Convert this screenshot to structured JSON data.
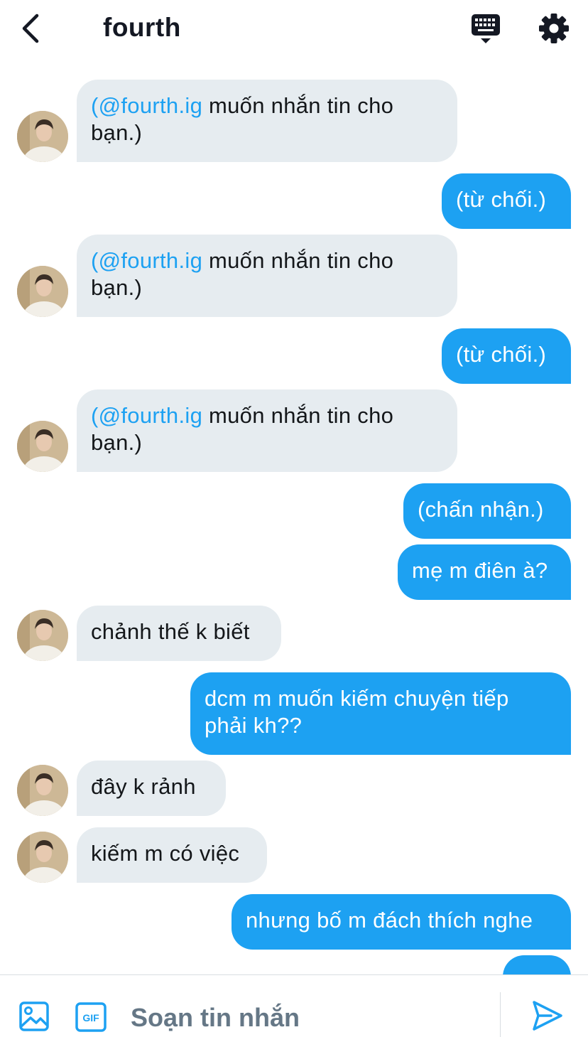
{
  "header": {
    "title": "fourth",
    "back_icon": "chevron-left-icon",
    "keyboard_icon": "keyboard-icon",
    "settings_icon": "gear-icon"
  },
  "colors": {
    "accent": "#1da1f2",
    "incoming_bubble": "#e6ecf0",
    "text": "#14171a",
    "placeholder": "#657786"
  },
  "messages": [
    {
      "dir": "in",
      "mention": "(@fourth.ig",
      "line1_rest": " muốn nhắn tin cho",
      "line2": "bạn.)"
    },
    {
      "dir": "out",
      "text": "(từ chối.)"
    },
    {
      "dir": "in",
      "mention": "(@fourth.ig",
      "line1_rest": " muốn nhắn tin cho",
      "line2": "bạn.)"
    },
    {
      "dir": "out",
      "text": "(từ chối.)"
    },
    {
      "dir": "in",
      "mention": "(@fourth.ig",
      "line1_rest": " muốn nhắn tin cho",
      "line2": "bạn.)"
    },
    {
      "dir": "out",
      "text": "(chấn nhận.)"
    },
    {
      "dir": "out",
      "text": "mẹ m điên à?"
    },
    {
      "dir": "in",
      "text": "chảnh thế k biết"
    },
    {
      "dir": "out",
      "line1": "dcm m muốn kiếm chuyện tiếp",
      "line2": "phải kh??"
    },
    {
      "dir": "in",
      "text": "đây k rảnh"
    },
    {
      "dir": "in",
      "text": "kiếm m có việc"
    },
    {
      "dir": "out",
      "text": "nhưng bố m đách thích nghe"
    }
  ],
  "composer": {
    "placeholder": "Soạn tin nhắn",
    "media_icon": "image-icon",
    "gif_icon": "gif-icon",
    "gif_label": "GIF",
    "send_icon": "send-icon"
  }
}
